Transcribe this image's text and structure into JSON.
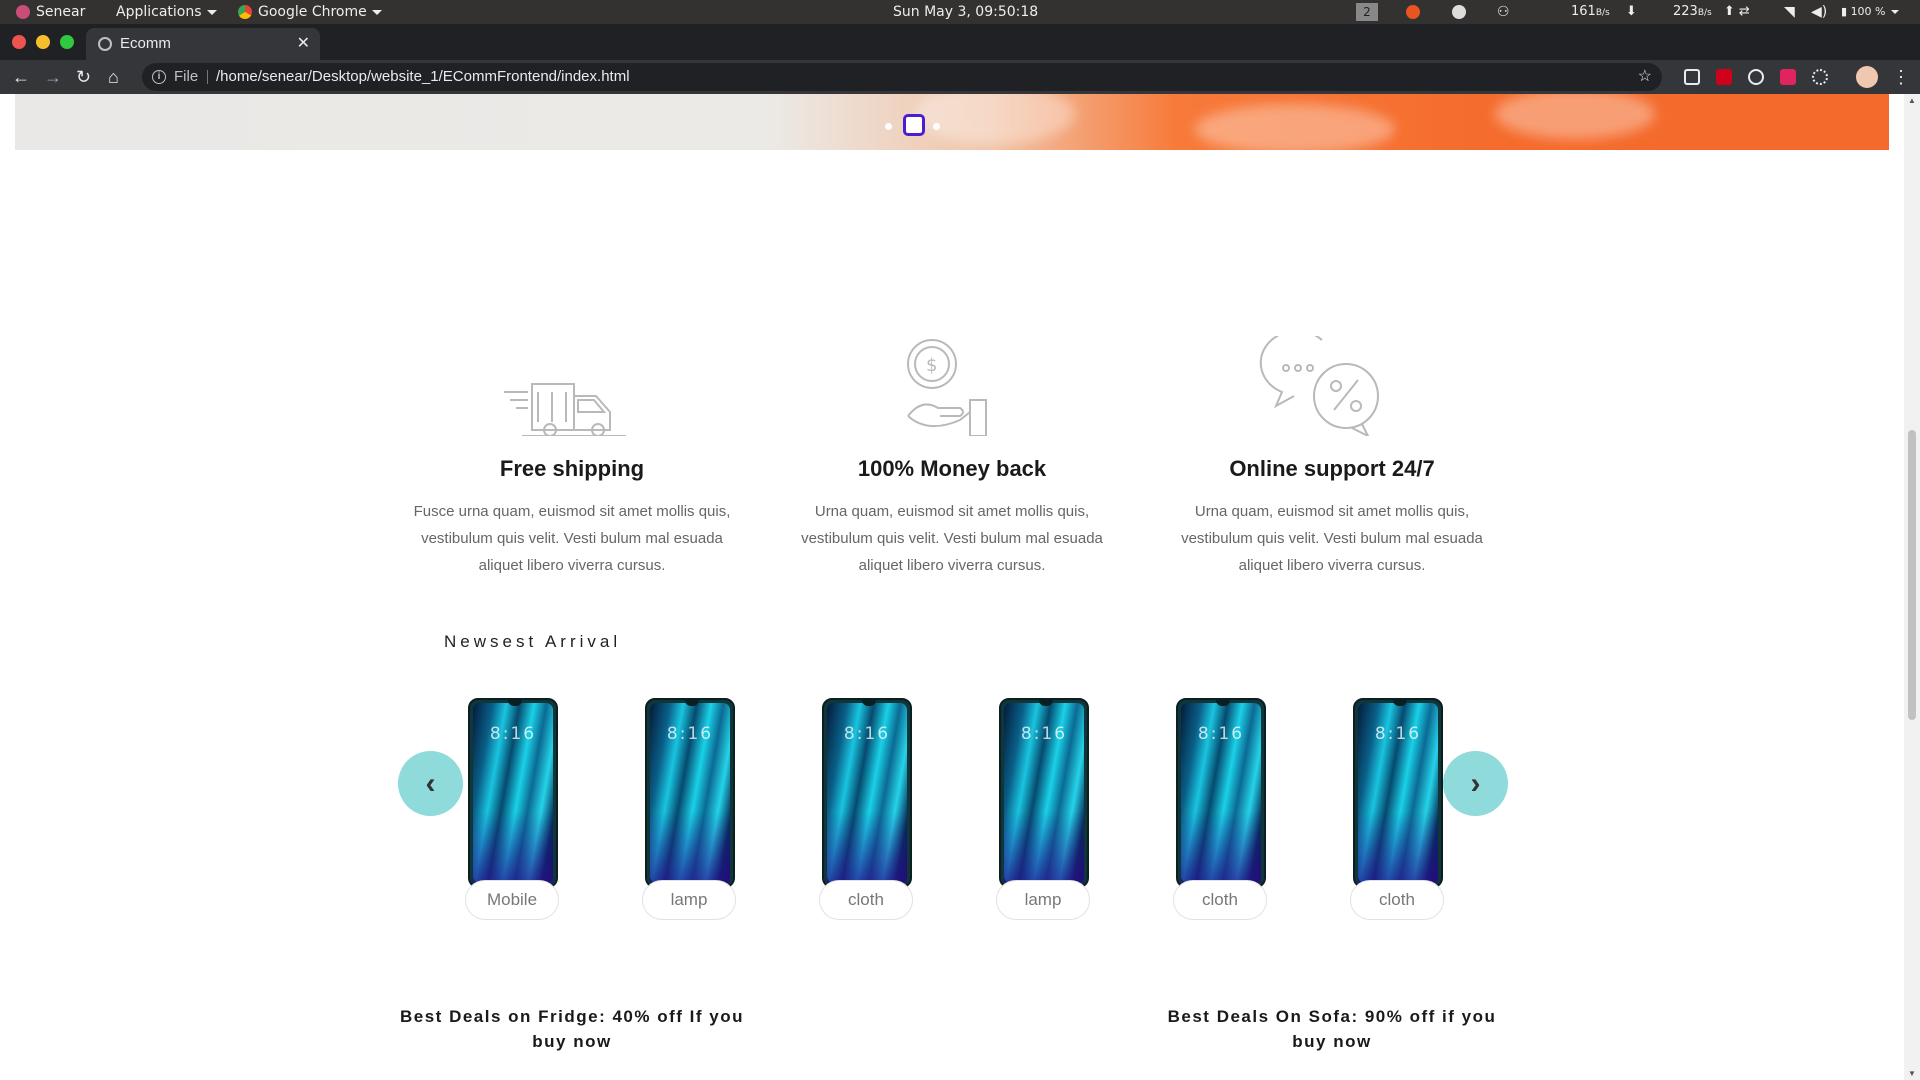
{
  "system_bar": {
    "user": "Senear",
    "applications": "Applications",
    "active_app": "Google Chrome",
    "clock": "Sun May  3, 09:50:18",
    "workspace": "2",
    "net_down": "161",
    "net_down_unit": "B/s",
    "net_up": "223",
    "net_up_unit": "B/s",
    "battery": "100 %"
  },
  "browser": {
    "tab_title": "Ecomm",
    "tab_close": "✕",
    "new_tab": "+",
    "scheme_label": "File",
    "url": "/home/senear/Desktop/website_1/ECommFrontend/index.html"
  },
  "features": [
    {
      "icon": "truck-icon",
      "title": "Free shipping",
      "text": "Fusce urna quam, euismod sit amet mollis quis, vestibulum quis velit. Vesti bulum mal esuada aliquet libero viverra cursus."
    },
    {
      "icon": "money-back-icon",
      "title": "100% Money back",
      "text": "Urna quam, euismod sit amet mollis quis, vestibulum quis velit. Vesti bulum mal esuada aliquet libero viverra cursus."
    },
    {
      "icon": "chat-support-icon",
      "title": "Online support 24/7",
      "text": "Urna quam, euismod sit amet mollis quis, vestibulum quis velit. Vesti bulum mal esuada aliquet libero viverra cursus."
    }
  ],
  "arrival": {
    "title": "Newsest Arrival",
    "prev_icon": "‹",
    "next_icon": "›",
    "phone_time": "8:16",
    "products": [
      {
        "label": "Mobile"
      },
      {
        "label": "lamp"
      },
      {
        "label": "cloth"
      },
      {
        "label": "lamp"
      },
      {
        "label": "cloth"
      },
      {
        "label": "cloth"
      }
    ]
  },
  "deals": [
    {
      "text": "Best Deals on Fridge: 40% off If you buy now"
    },
    {
      "text": "Best Deals On Sofa: 90% off if you buy now"
    }
  ],
  "slider": {
    "slide_count": 3,
    "active_index": 1
  },
  "colors": {
    "accent_arrow": "#8fdada",
    "active_dot_border": "#4b1ed2",
    "hero_orange": "#f56b2c"
  }
}
